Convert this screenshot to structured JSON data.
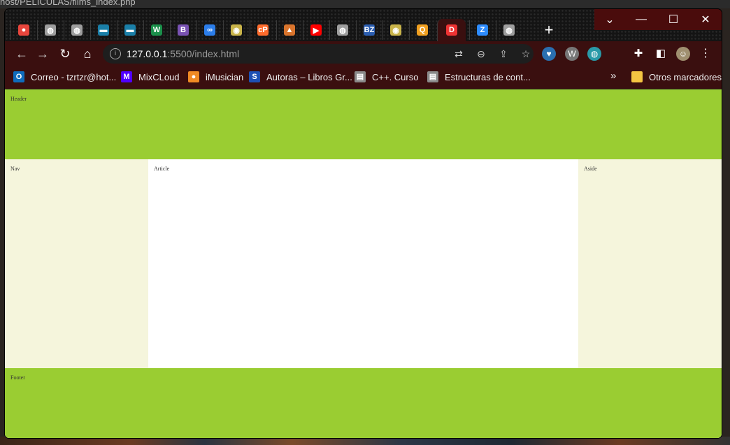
{
  "behind": {
    "title_fragment": "host/PELICULAS/films_index.php"
  },
  "window_controls": {
    "chevron": "⌄",
    "minimize": "—",
    "maximize": "☐",
    "close": "✕"
  },
  "tabs": [
    {
      "icon": "chrome-icon",
      "glyph": "●",
      "color": "#e8453c"
    },
    {
      "icon": "globe-icon",
      "glyph": "◍",
      "color": "#9e9e9e"
    },
    {
      "icon": "globe-icon",
      "glyph": "◍",
      "color": "#9e9e9e"
    },
    {
      "icon": "dash-icon",
      "glyph": "▬",
      "color": "#1a7fa8"
    },
    {
      "icon": "dash-icon",
      "glyph": "▬",
      "color": "#1a7fa8"
    },
    {
      "icon": "w-icon",
      "glyph": "W",
      "color": "#1a8f4a"
    },
    {
      "icon": "bootstrap-icon",
      "glyph": "B",
      "color": "#7952b3"
    },
    {
      "icon": "infinity-icon",
      "glyph": "∞",
      "color": "#2b7de9"
    },
    {
      "icon": "clock-icon",
      "glyph": "◉",
      "color": "#c9b44a"
    },
    {
      "icon": "cpanel-icon",
      "glyph": "cP",
      "color": "#ff6c2c"
    },
    {
      "icon": "fire-icon",
      "glyph": "▲",
      "color": "#d9742c"
    },
    {
      "icon": "youtube-icon",
      "glyph": "▶",
      "color": "#ff0000"
    },
    {
      "icon": "globe-icon",
      "glyph": "◍",
      "color": "#9e9e9e"
    },
    {
      "icon": "bz-icon",
      "glyph": "BZ",
      "color": "#2a5db0"
    },
    {
      "icon": "clock-icon",
      "glyph": "◉",
      "color": "#c9b44a"
    },
    {
      "icon": "q-icon",
      "glyph": "Q",
      "color": "#f0a020"
    },
    {
      "icon": "doc-icon",
      "glyph": "D",
      "color": "#3a0f0f",
      "active": true
    },
    {
      "icon": "zoom-icon",
      "glyph": "Z",
      "color": "#2d8cff"
    },
    {
      "icon": "globe-icon",
      "glyph": "◍",
      "color": "#9e9e9e"
    }
  ],
  "new_tab": "+",
  "toolbar": {
    "back": "←",
    "forward": "→",
    "reload": "↻",
    "home": "⌂",
    "url_host": "127.0.0.1",
    "url_rest": ":5500/index.html"
  },
  "bookmarks": [
    {
      "label": "Correo - tzrtzr@hot...",
      "icon": "outlook-icon",
      "glyph": "O",
      "color": "#0f6cbd"
    },
    {
      "label": "MixCLoud",
      "icon": "mixcloud-icon",
      "glyph": "M",
      "color": "#5000ff"
    },
    {
      "label": "iMusician",
      "icon": "imusician-icon",
      "glyph": "●",
      "color": "#f08a24"
    },
    {
      "label": "Autoras – Libros Gr...",
      "icon": "s-icon",
      "glyph": "S",
      "color": "#1e50b4"
    },
    {
      "label": "C++. Curso",
      "icon": "book-icon",
      "glyph": "▤",
      "color": "#8a8a8a"
    },
    {
      "label": "Estructuras de cont...",
      "icon": "book-icon",
      "glyph": "▤",
      "color": "#8a8a8a"
    }
  ],
  "bookmarks_overflow": "»",
  "other_bookmarks": "Otros marcadores",
  "page": {
    "header": "Header",
    "nav": "Nav",
    "article": "Article",
    "aside": "Aside",
    "footer": "Footer"
  }
}
